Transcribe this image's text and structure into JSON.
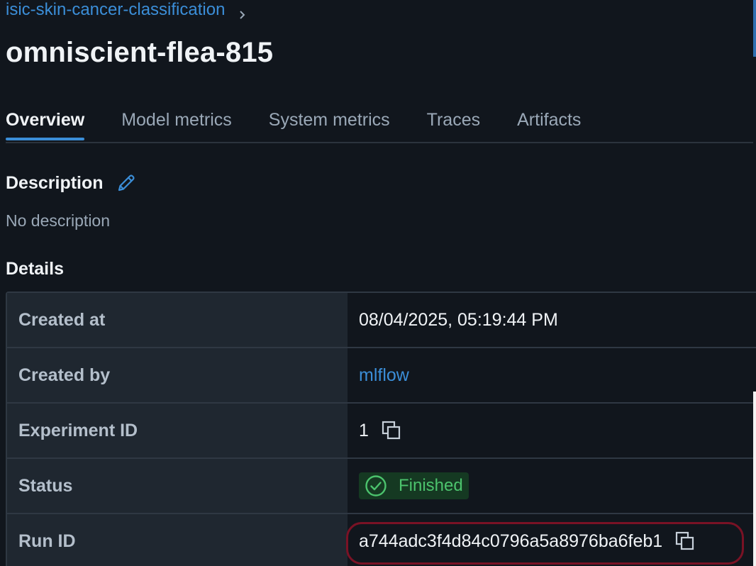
{
  "breadcrumb": {
    "experiment": "isic-skin-cancer-classification"
  },
  "run": {
    "name": "omniscient-flea-815"
  },
  "tabs": [
    {
      "label": "Overview",
      "active": true
    },
    {
      "label": "Model metrics",
      "active": false
    },
    {
      "label": "System metrics",
      "active": false
    },
    {
      "label": "Traces",
      "active": false
    },
    {
      "label": "Artifacts",
      "active": false
    }
  ],
  "description": {
    "heading": "Description",
    "text": "No description"
  },
  "details": {
    "heading": "Details",
    "rows": [
      {
        "key": "Created at",
        "value": "08/04/2025, 05:19:44 PM"
      },
      {
        "key": "Created by",
        "value": "mlflow"
      },
      {
        "key": "Experiment ID",
        "value": "1"
      },
      {
        "key": "Status",
        "value": "Finished"
      },
      {
        "key": "Run ID",
        "value": "a744adc3f4d84c0796a5a8976ba6feb1"
      }
    ]
  },
  "colors": {
    "accent": "#3b8ed8",
    "success": "#4cc36d",
    "background": "#11161d",
    "highlight": "#7a1225"
  }
}
